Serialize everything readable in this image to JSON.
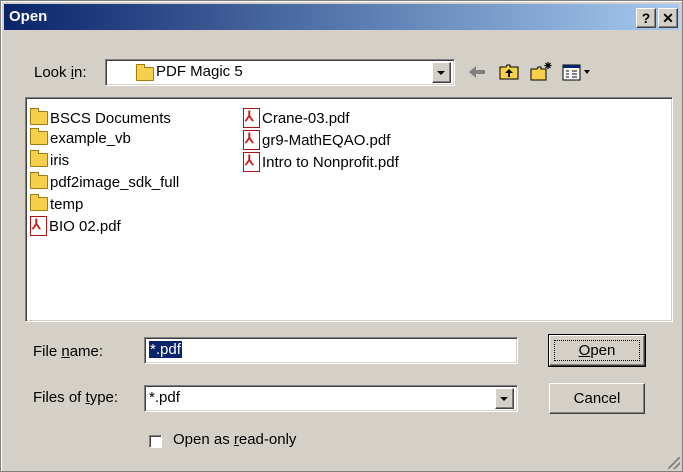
{
  "window": {
    "title": "Open",
    "help_label": "?",
    "close_label": "✕"
  },
  "lookin": {
    "label_pre": "Look ",
    "label_key": "i",
    "label_post": "n:",
    "value": "PDF Magic 5"
  },
  "toolbar": {
    "icons": [
      "back-arrow-icon",
      "up-one-level-icon",
      "new-folder-icon",
      "view-menu-icon"
    ]
  },
  "files": {
    "column1": [
      {
        "name": "BSCS Documents",
        "type": "folder"
      },
      {
        "name": "example_vb",
        "type": "folder"
      },
      {
        "name": "iris",
        "type": "folder"
      },
      {
        "name": "pdf2image_sdk_full",
        "type": "folder"
      },
      {
        "name": "temp",
        "type": "folder"
      },
      {
        "name": "BIO 02.pdf",
        "type": "pdf"
      }
    ],
    "column2": [
      {
        "name": "Crane-03.pdf",
        "type": "pdf"
      },
      {
        "name": "gr9-MathEQAO.pdf",
        "type": "pdf"
      },
      {
        "name": "Intro to Nonprofit.pdf",
        "type": "pdf"
      }
    ]
  },
  "filename": {
    "label_pre": "File ",
    "label_key": "n",
    "label_post": "ame:",
    "value": "*.pdf"
  },
  "filetype": {
    "label_pre": "Files of ",
    "label_key": "t",
    "label_post": "ype:",
    "value": "*.pdf"
  },
  "buttons": {
    "open_key": "O",
    "open_rest": "pen",
    "cancel": "Cancel"
  },
  "readonly": {
    "label_pre": "Open as ",
    "label_key": "r",
    "label_post": "ead-only",
    "checked": false
  }
}
